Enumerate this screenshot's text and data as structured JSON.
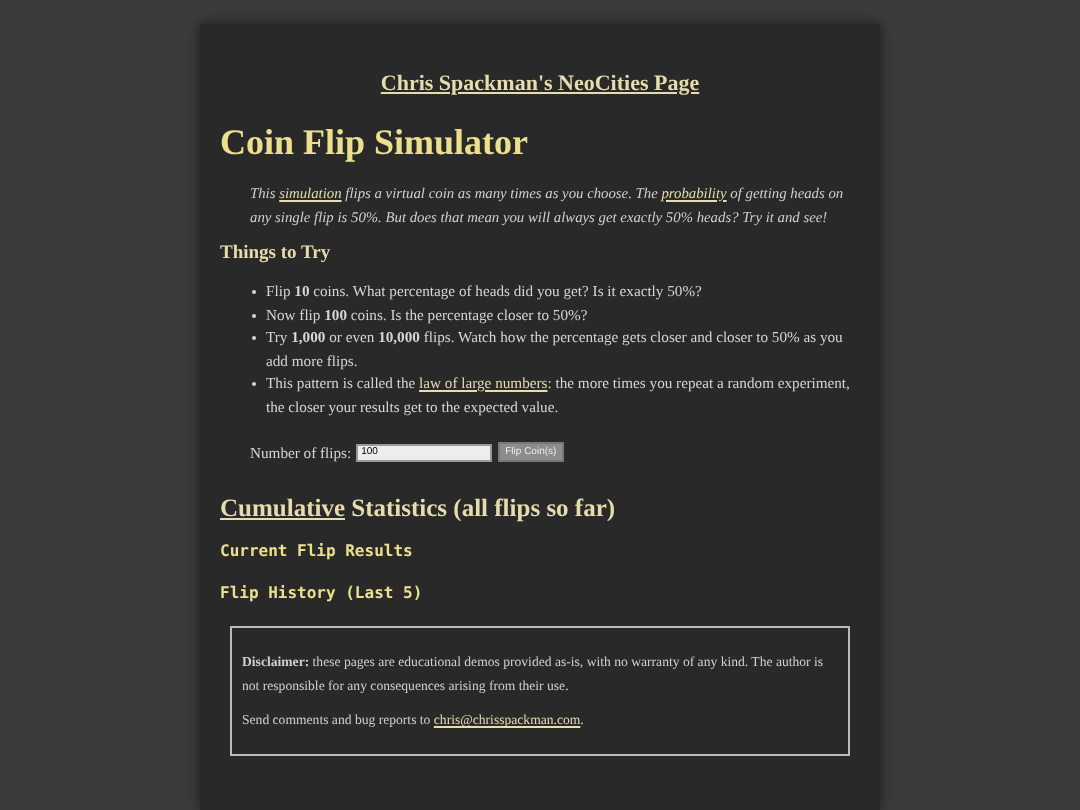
{
  "site_link": "Chris Spackman's NeoCities Page",
  "title": "Coin Flip Simulator",
  "intro": [
    {
      "kind": "text",
      "text": "This "
    },
    {
      "kind": "link",
      "text": "simulation"
    },
    {
      "kind": "text",
      "text": " flips a virtual coin as many times as you choose. The "
    },
    {
      "kind": "link",
      "text": "probability"
    },
    {
      "kind": "text",
      "text": " of getting heads on any single flip is 50%. But does that mean you will always get exactly 50% heads? Try it and see!"
    }
  ],
  "things_heading": "Things to Try",
  "things": [
    [
      {
        "kind": "text",
        "text": "Flip **10** coins. What percentage of heads did you get? Is it exactly 50%?"
      }
    ],
    [
      {
        "kind": "text",
        "text": "Now flip **100** coins. Is the percentage closer to 50%?"
      }
    ],
    [
      {
        "kind": "text",
        "text": "Try **1,000** or even **10,000** flips. Watch how the percentage gets closer and closer to 50% as you add more flips."
      }
    ],
    [
      {
        "kind": "text",
        "text": "This pattern is called the "
      },
      {
        "kind": "link",
        "text": "law of large numbers"
      },
      {
        "kind": "text",
        "text": ": the more times you repeat a random experiment, the closer your results get to the expected value."
      }
    ]
  ],
  "flips_label": "Number of flips:",
  "flips_value": "100",
  "flip_button": "Flip Coin(s)",
  "stats_heading": [
    {
      "kind": "link",
      "text": "Cumulative"
    },
    {
      "kind": "text",
      "text": " Statistics (all flips so far)"
    }
  ],
  "current_heading": "Current Flip Results",
  "history_heading": "Flip History (Last 5)",
  "disclaimer": [
    {
      "kind": "text",
      "text": "**Disclaimer:** these pages are educational demos provided as-is, with no warranty of any kind. The author is not responsible for any consequences arising from their use."
    }
  ],
  "contact": [
    {
      "kind": "text",
      "text": "Send comments and bug reports to "
    },
    {
      "kind": "link",
      "text": "chris@chrisspackman.com"
    },
    {
      "kind": "text",
      "text": "."
    }
  ]
}
